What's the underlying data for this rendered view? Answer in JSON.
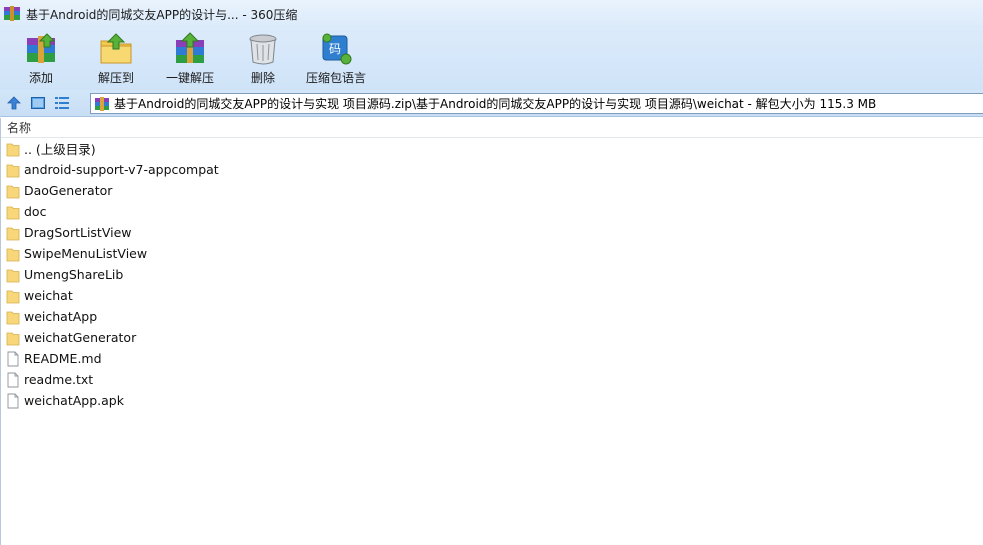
{
  "window": {
    "title": "基于Android的同城交友APP的设计与... - 360压缩"
  },
  "toolbar": {
    "buttons": [
      {
        "label": "添加",
        "icon": "add-archive-icon"
      },
      {
        "label": "解压到",
        "icon": "extract-to-icon"
      },
      {
        "label": "一键解压",
        "icon": "one-click-extract-icon"
      },
      {
        "label": "删除",
        "icon": "trash-icon"
      },
      {
        "label": "压缩包语言",
        "icon": "archive-language-icon"
      }
    ]
  },
  "address": {
    "path": "基于Android的同城交友APP的设计与实现 项目源码.zip\\基于Android的同城交友APP的设计与实现 项目源码\\weichat - 解包大小为 115.3 MB"
  },
  "list": {
    "column_name": "名称",
    "items": [
      {
        "name": ".. (上级目录)",
        "type": "folder"
      },
      {
        "name": "android-support-v7-appcompat",
        "type": "folder"
      },
      {
        "name": "DaoGenerator",
        "type": "folder"
      },
      {
        "name": "doc",
        "type": "folder"
      },
      {
        "name": "DragSortListView",
        "type": "folder"
      },
      {
        "name": "SwipeMenuListView",
        "type": "folder"
      },
      {
        "name": "UmengShareLib",
        "type": "folder"
      },
      {
        "name": "weichat",
        "type": "folder"
      },
      {
        "name": "weichatApp",
        "type": "folder"
      },
      {
        "name": "weichatGenerator",
        "type": "folder"
      },
      {
        "name": "README.md",
        "type": "file"
      },
      {
        "name": "readme.txt",
        "type": "file"
      },
      {
        "name": "weichatApp.apk",
        "type": "file"
      }
    ]
  },
  "colors": {
    "folder": "#f7d77a",
    "accent": "#2f7fd0"
  }
}
